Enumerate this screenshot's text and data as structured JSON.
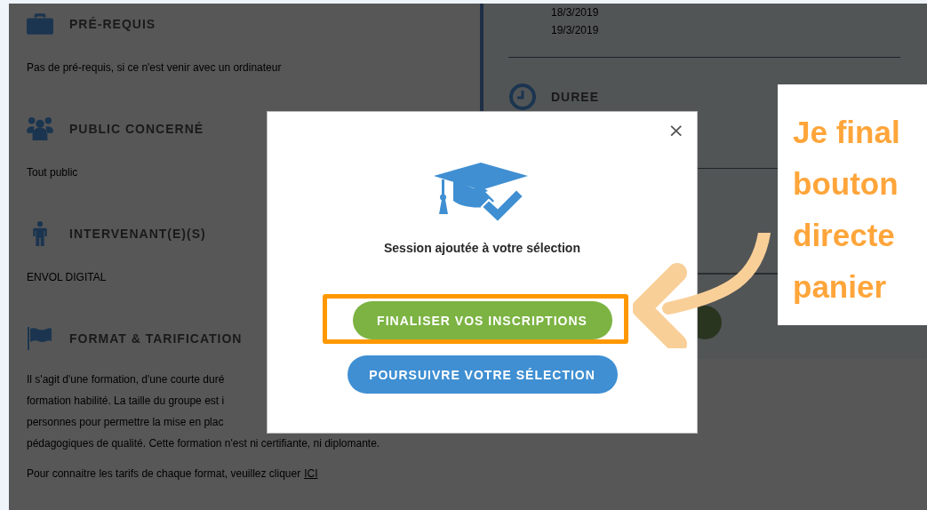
{
  "sections": [
    {
      "kind": "briefcase",
      "title": "PRÉ-REQUIS",
      "lines": [
        "Pas de pré-requis, si ce n'est venir avec un ordinateur"
      ]
    },
    {
      "kind": "group",
      "title": "PUBLIC CONCERNÉ",
      "lines": [
        "Tout public"
      ]
    },
    {
      "kind": "person",
      "title": "INTERVENANT(E)(S)",
      "lines": [
        "ENVOL DIGITAL"
      ]
    },
    {
      "kind": "flag",
      "title": "FORMAT & TARIFICATION",
      "lines": [
        "Il s'agit d'une formation, d'une courte duré",
        "formation habilité. La taille du groupe est i",
        "personnes pour permettre la mise en plac",
        "pédagogiques de qualité. Cette formation n'est ni certifiante, ni diplomante."
      ]
    }
  ],
  "pricing_note": {
    "text": "Pour connaitre les tarifs de chaque format, veuillez cliquer",
    "link": "ICI"
  },
  "dates": [
    "18/3/2019",
    "19/3/2019"
  ],
  "duration": {
    "title": "DUREE"
  },
  "modal": {
    "close": "×",
    "message": "Session ajoutée à votre sélection",
    "buttons": [
      {
        "label": "FINALISER VOS INSCRIPTIONS",
        "kind": "primary",
        "highlighted": true
      },
      {
        "label": "POURSUIVRE VOTRE SÉLECTION",
        "kind": "secondary",
        "highlighted": false
      }
    ]
  },
  "callout": {
    "lines": [
      "Je final",
      "bouton",
      "directe",
      "panier"
    ]
  }
}
